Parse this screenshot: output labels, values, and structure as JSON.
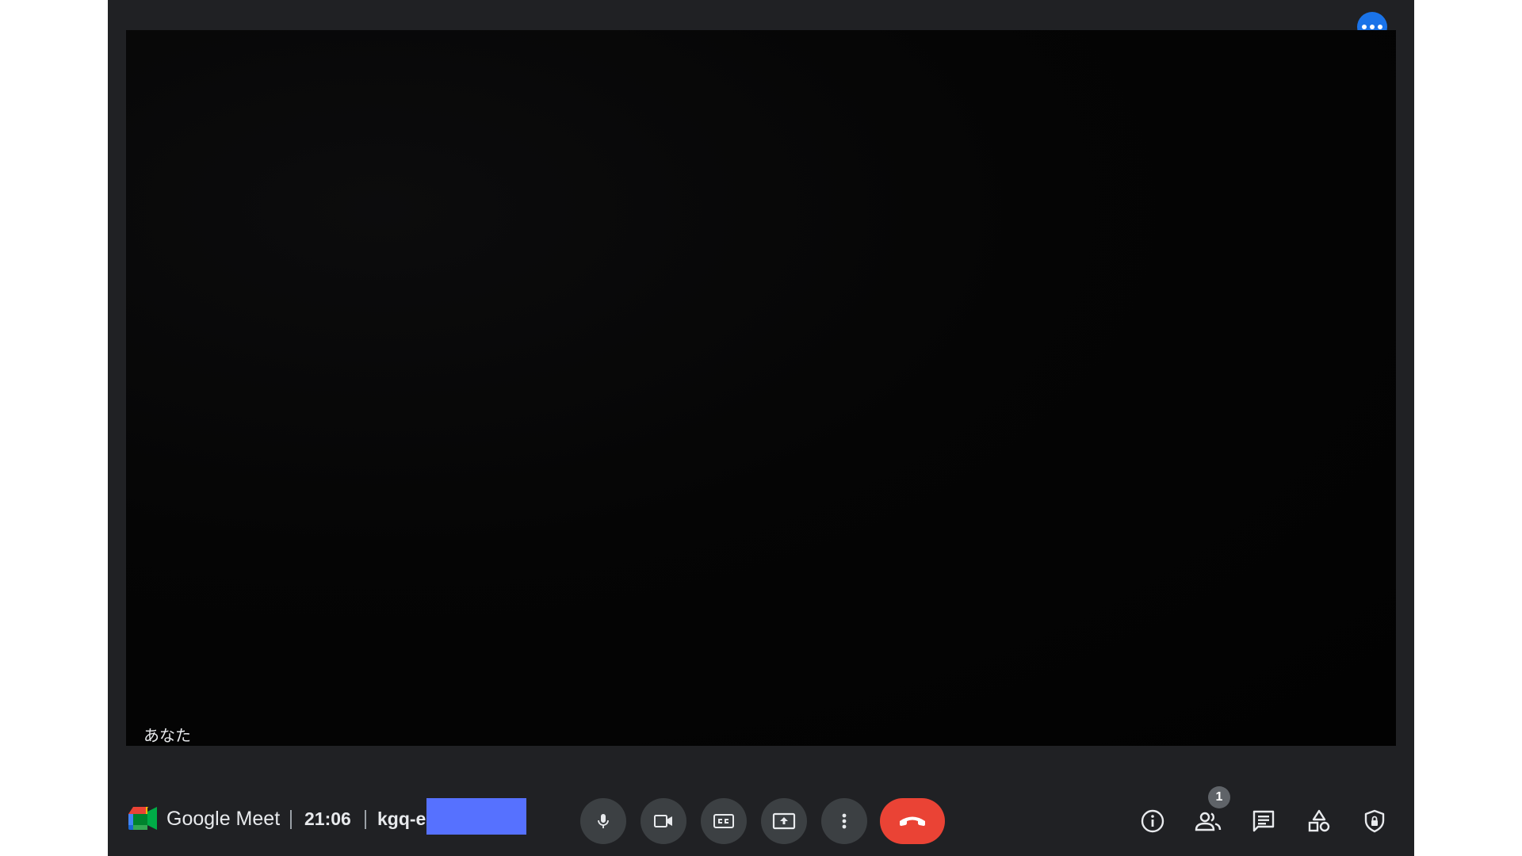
{
  "app": {
    "brand_name": "Google Meet",
    "time": "21:06",
    "meeting_code_visible": "kgq-e"
  },
  "video": {
    "self_label": "あなた"
  },
  "participants": {
    "count": "1"
  },
  "icons": {
    "top_more": "more-horiz-icon",
    "mic": "microphone-icon",
    "camera": "video-camera-icon",
    "captions": "closed-captions-icon",
    "present": "present-screen-icon",
    "more": "more-vert-icon",
    "hangup": "hang-up-icon",
    "info": "info-icon",
    "people": "people-icon",
    "chat": "chat-icon",
    "activities": "activities-icon",
    "host_controls": "shield-lock-icon"
  },
  "colors": {
    "background": "#202124",
    "control_button": "#3c4043",
    "hangup": "#ea4335",
    "accent": "#1a73e8",
    "redaction": "#5671ff"
  }
}
